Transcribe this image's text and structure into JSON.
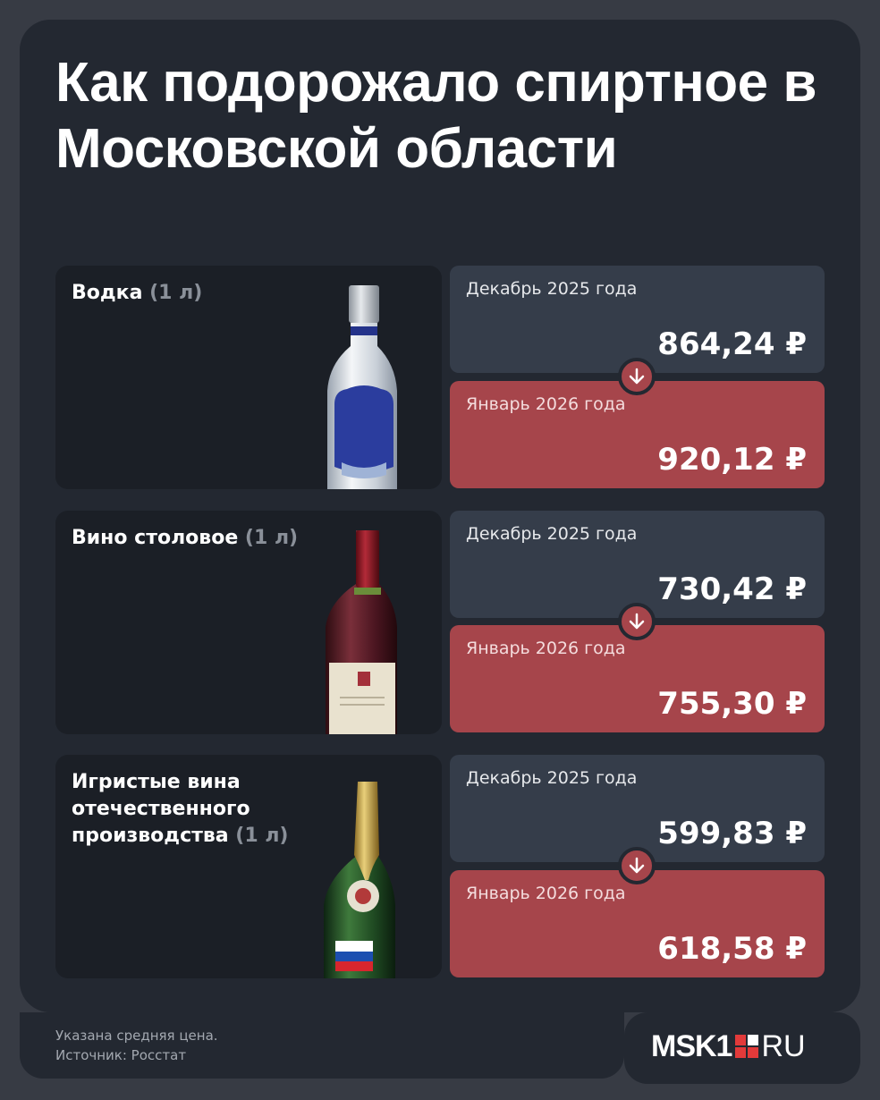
{
  "title": "Как подорожало спиртное в Московской области",
  "items": [
    {
      "name": "Водка",
      "volume": "(1 л)",
      "dec_label": "Декабрь 2025 года",
      "dec_price": "864,24 ₽",
      "jan_label": "Январь 2026 года",
      "jan_price": "920,12 ₽",
      "image": "vodka-bottle"
    },
    {
      "name": "Вино столовое",
      "volume": "(1 л)",
      "dec_label": "Декабрь 2025 года",
      "dec_price": "730,42 ₽",
      "jan_label": "Январь 2026 года",
      "jan_price": "755,30 ₽",
      "image": "wine-bottle"
    },
    {
      "name": "Игристые вина отечественного производства",
      "volume": "(1 л)",
      "dec_label": "Декабрь 2025 года",
      "dec_price": "599,83 ₽",
      "jan_label": "Январь 2026 года",
      "jan_price": "618,58 ₽",
      "image": "sparkling-wine-bottle"
    }
  ],
  "arrow_icon": "arrow-down-icon",
  "footnote": {
    "line1": "Указана средняя цена.",
    "line2": "Источник: Росстат"
  },
  "logo": {
    "left": "MSK1",
    "right": "RU"
  },
  "colors": {
    "background": "#373b44",
    "card": "#232831",
    "december": "#353d4a",
    "january": "#a6454b"
  }
}
